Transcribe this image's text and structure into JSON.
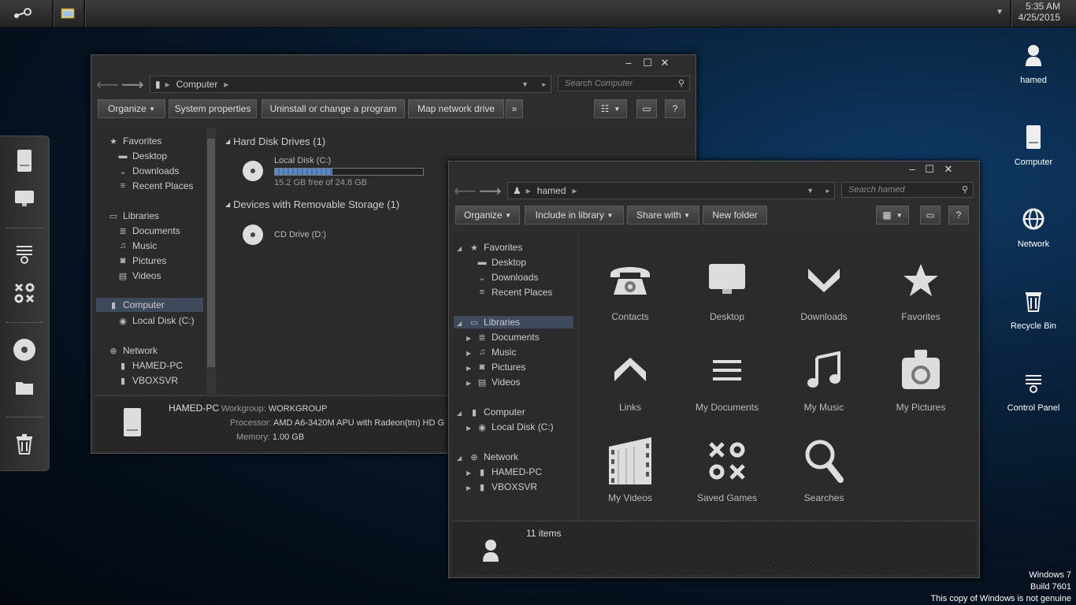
{
  "taskbar": {
    "time": "5:35 AM",
    "date": "4/25/2015",
    "apps": [
      "steam-icon",
      "explorer-icon"
    ]
  },
  "dock": [
    "computer-icon",
    "monitor-icon",
    "control-panel-icon",
    "games-icon",
    "disc-icon",
    "folder-icon",
    "recycle-bin-icon"
  ],
  "desktop": {
    "icons": [
      {
        "label": "hamed",
        "icon": "user-icon"
      },
      {
        "label": "Computer",
        "icon": "computer-icon"
      },
      {
        "label": "Network",
        "icon": "network-icon"
      },
      {
        "label": "Recycle Bin",
        "icon": "recycle-bin-icon"
      },
      {
        "label": "Control Panel",
        "icon": "control-panel-icon"
      }
    ],
    "genuine": {
      "line1": "Windows 7",
      "line2": "Build 7601",
      "line3": "This copy of Windows is not genuine"
    }
  },
  "win1": {
    "address": "Computer",
    "search_placeholder": "Search Computer",
    "toolbar": {
      "organize": "Organize",
      "system_properties": "System properties",
      "uninstall": "Uninstall or change a program",
      "map_drive": "Map network drive",
      "more": "»"
    },
    "nav": {
      "favorites": "Favorites",
      "desktop": "Desktop",
      "downloads": "Downloads",
      "recent": "Recent Places",
      "libraries": "Libraries",
      "documents": "Documents",
      "music": "Music",
      "pictures": "Pictures",
      "videos": "Videos",
      "computer": "Computer",
      "local_disk": "Local Disk (C:)",
      "network": "Network",
      "hamed_pc": "HAMED-PC",
      "vboxsvr": "VBOXSVR"
    },
    "content": {
      "hdd_group": "Hard Disk Drives (1)",
      "local_disk": "Local Disk (C:)",
      "disk_fill": 0.387,
      "free_text": "15.2 GB free of 24.8 GB",
      "removable_group": "Devices with Removable Storage (1)",
      "cd_drive": "CD Drive (D:)"
    },
    "details": {
      "name": "HAMED-PC",
      "workgroup_label": "Workgroup:",
      "workgroup": "WORKGROUP",
      "processor_label": "Processor:",
      "processor": "AMD A6-3420M APU with Radeon(tm) HD G",
      "memory_label": "Memory:",
      "memory": "1.00 GB"
    }
  },
  "win2": {
    "address": "hamed",
    "search_placeholder": "Search hamed",
    "toolbar": {
      "organize": "Organize",
      "include": "Include in library",
      "share": "Share with",
      "new_folder": "New folder"
    },
    "nav": {
      "favorites": "Favorites",
      "desktop": "Desktop",
      "downloads": "Downloads",
      "recent": "Recent Places",
      "libraries": "Libraries",
      "documents": "Documents",
      "music": "Music",
      "pictures": "Pictures",
      "videos": "Videos",
      "computer": "Computer",
      "local_disk": "Local Disk (C:)",
      "network": "Network",
      "hamed_pc": "HAMED-PC",
      "vboxsvr": "VBOXSVR"
    },
    "items": [
      {
        "label": "Contacts",
        "icon": "phone-icon"
      },
      {
        "label": "Desktop",
        "icon": "monitor-icon"
      },
      {
        "label": "Downloads",
        "icon": "chevron-down-icon"
      },
      {
        "label": "Favorites",
        "icon": "star-icon"
      },
      {
        "label": "Links",
        "icon": "chevron-up-icon"
      },
      {
        "label": "My Documents",
        "icon": "lines-icon"
      },
      {
        "label": "My Music",
        "icon": "music-note-icon"
      },
      {
        "label": "My Pictures",
        "icon": "camera-icon"
      },
      {
        "label": "My Videos",
        "icon": "film-icon"
      },
      {
        "label": "Saved Games",
        "icon": "tic-tac-toe-icon"
      },
      {
        "label": "Searches",
        "icon": "magnifier-icon"
      }
    ],
    "status": "11 items"
  }
}
